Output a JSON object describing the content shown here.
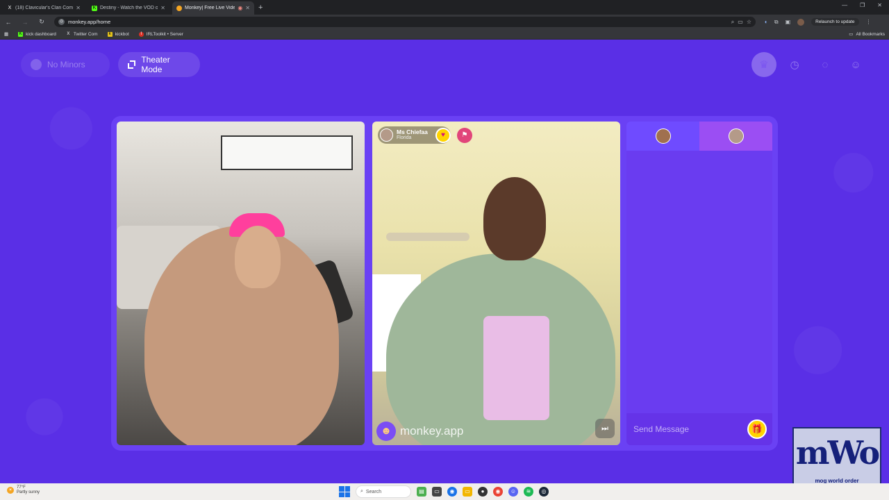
{
  "browser": {
    "tabs": [
      {
        "title": "(18) Clavicular's Clan Commun",
        "favicon": "X",
        "color": "#000000",
        "active": false
      },
      {
        "title": "Destiny - Watch the VOD on Ki",
        "favicon": "K",
        "color": "#53fc18",
        "active": false
      },
      {
        "title": "Monkey| Free Live Video Ch",
        "favicon": "M",
        "color": "#f5a623",
        "active": true
      }
    ],
    "new_tab": "+",
    "url": "monkey.app/home",
    "relaunch_label": "Relaunch to update",
    "bookmarks": [
      {
        "label": "kick dashboard",
        "icon": "K",
        "color": "#53fc18"
      },
      {
        "label": "Twitter Com",
        "icon": "X",
        "color": "#000000"
      },
      {
        "label": "kickbot",
        "icon": "k",
        "color": "#e3c21b"
      },
      {
        "label": "IRLToolkit • Server",
        "icon": "I",
        "color": "#d93025"
      }
    ],
    "all_bookmarks": "All Bookmarks"
  },
  "app": {
    "no_minors_label": "No Minors",
    "theater_label": "Theater Mode",
    "top_icons": [
      "crown-icon",
      "clock-icon",
      "chat-icon",
      "profile-icon"
    ],
    "caller": {
      "name": "Ms Chiefaa",
      "location": "Florida"
    },
    "watermark": "monkey.app",
    "chat": {
      "placeholder": "Send Message"
    },
    "overlay": {
      "logo_text": "mWo",
      "tagline": "mog world order"
    }
  },
  "taskbar": {
    "temperature": "77°F",
    "condition": "Partly sunny",
    "search_placeholder": "Search"
  },
  "colors": {
    "app_bg": "#5a2fe6",
    "accent_yellow": "#ffd400"
  }
}
